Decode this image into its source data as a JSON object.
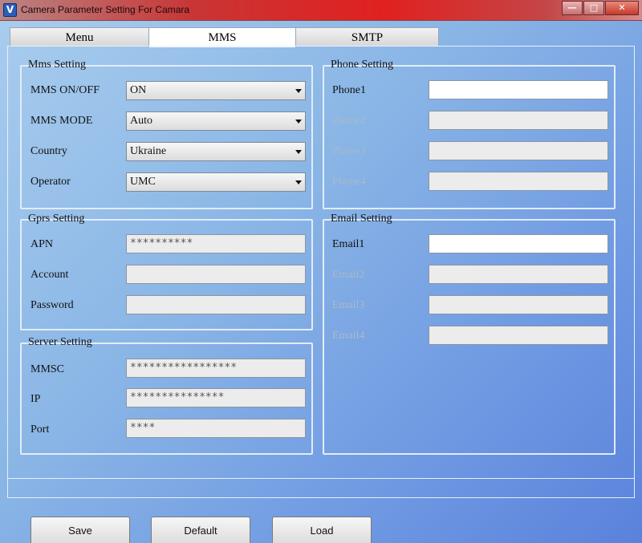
{
  "window": {
    "title": "Camera Parameter Setting For  Camara",
    "icon": "v-logo-icon"
  },
  "tabs": [
    {
      "label": "Menu"
    },
    {
      "label": "MMS"
    },
    {
      "label": "SMTP"
    }
  ],
  "mms_setting": {
    "legend": "Mms Setting",
    "rows": [
      {
        "label": "MMS ON/OFF",
        "value": "ON"
      },
      {
        "label": "MMS MODE",
        "value": "Auto"
      },
      {
        "label": "Country",
        "value": "Ukraine"
      },
      {
        "label": "Operator",
        "value": "UMC"
      }
    ]
  },
  "gprs_setting": {
    "legend": "Gprs Setting",
    "rows": [
      {
        "label": "APN",
        "value": "**********"
      },
      {
        "label": "Account",
        "value": ""
      },
      {
        "label": "Password",
        "value": ""
      }
    ]
  },
  "server_setting": {
    "legend": "Server Setting",
    "rows": [
      {
        "label": "MMSC",
        "value": "*****************"
      },
      {
        "label": "IP",
        "value": "***************"
      },
      {
        "label": "Port",
        "value": "****"
      }
    ]
  },
  "phone_setting": {
    "legend": "Phone Setting",
    "rows": [
      {
        "label": "Phone1",
        "value": ""
      },
      {
        "label": "Phone2",
        "value": ""
      },
      {
        "label": "Phone3",
        "value": ""
      },
      {
        "label": "Phone4",
        "value": ""
      }
    ]
  },
  "email_setting": {
    "legend": "Email Setting",
    "rows": [
      {
        "label": "Email1",
        "value": ""
      },
      {
        "label": "Email2",
        "value": ""
      },
      {
        "label": "Email3",
        "value": ""
      },
      {
        "label": "Email4",
        "value": ""
      }
    ]
  },
  "buttons": {
    "save": "Save",
    "default": "Default",
    "load": "Load"
  }
}
